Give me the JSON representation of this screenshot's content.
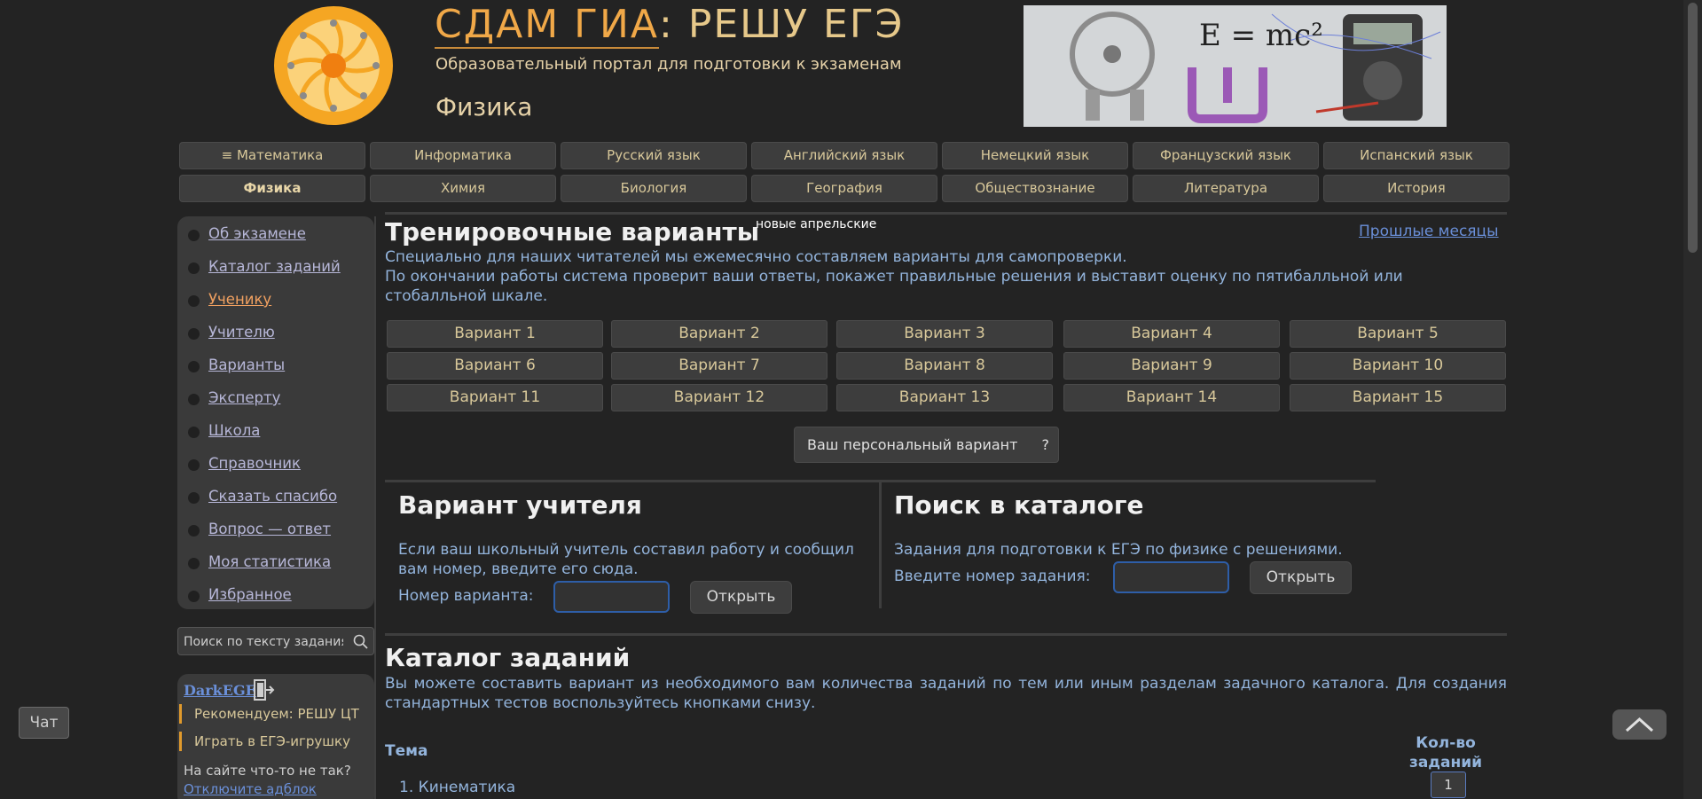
{
  "header": {
    "title_part1": "СДАМ ГИА",
    "title_sep": ":",
    "title_part2": "РЕШУ ЕГЭ",
    "subtitle": "Образовательный портал для подготовки к экзаменам",
    "subject": "Физика",
    "banner_formula": "E = mc²"
  },
  "subjects_row1": [
    "≡ Математика",
    "Информатика",
    "Русский язык",
    "Английский язык",
    "Немецкий язык",
    "Французский язык",
    "Испанский язык"
  ],
  "subjects_row2": [
    "Физика",
    "Химия",
    "Биология",
    "География",
    "Обществознание",
    "Литература",
    "История"
  ],
  "active_subject": "Физика",
  "sidebar": {
    "menu": [
      "Об экзамене",
      "Каталог заданий",
      "Ученику",
      "Учителю",
      "Варианты",
      "Эксперту",
      "Школа",
      "Справочник",
      "Сказать спасибо",
      "Вопрос — ответ",
      "Моя статистика",
      "Избранное"
    ],
    "current": "Ученику",
    "search_placeholder": "Поиск по тексту задания",
    "darkege": "DarkEGE",
    "promo": [
      "Рекомендуем: РЕШУ ЦТ",
      "Играть в ЕГЭ-игрушку"
    ],
    "adblock_text": "На сайте что-то не так?",
    "adblock_link": "Отключите адблок"
  },
  "training": {
    "title": "Тренировочные варианты",
    "badge": "новые апрельские",
    "past_months": "Прошлые месяцы",
    "desc1": "Специально для наших читателей мы ежемесячно составляем варианты для самопроверки.",
    "desc2": "По окончании работы система проверит ваши ответы, покажет правильные решения и выставит оценку по пятибалльной или стобалльной шкале.",
    "variants": [
      "Вариант 1",
      "Вариант 2",
      "Вариант 3",
      "Вариант 4",
      "Вариант 5",
      "Вариант 6",
      "Вариант 7",
      "Вариант 8",
      "Вариант 9",
      "Вариант 10",
      "Вариант 11",
      "Вариант 12",
      "Вариант 13",
      "Вариант 14",
      "Вариант 15"
    ],
    "personal": "Ваш персональный вариант",
    "personal_help": "?"
  },
  "teacher": {
    "title": "Вариант учителя",
    "desc": "Если ваш школьный учитель составил работу и сообщил вам номер, введите его сюда.",
    "label": "Номер варианта:",
    "button": "Открыть"
  },
  "catalog_search": {
    "title": "Поиск в каталоге",
    "desc": "Задания для подготовки к ЕГЭ по физике с решениями.",
    "label": "Введите номер задания:",
    "button": "Открыть"
  },
  "catalog": {
    "title": "Каталог заданий",
    "desc": "Вы можете составить вариант из необходимого вам количества заданий по тем или иным разделам задачного каталога. Для создания стандартных тестов воспользуйтесь кнопками снизу.",
    "col_topic": "Тема",
    "col_count": "Кол-во заданий",
    "rows": [
      {
        "topic": "1. Кинематика",
        "count": "1"
      }
    ]
  },
  "chat": "Чат",
  "colors": {
    "accent": "#f0a848",
    "link": "#6a8fd8",
    "text_blue": "#93b4dc",
    "button": "#3d3d3d"
  }
}
